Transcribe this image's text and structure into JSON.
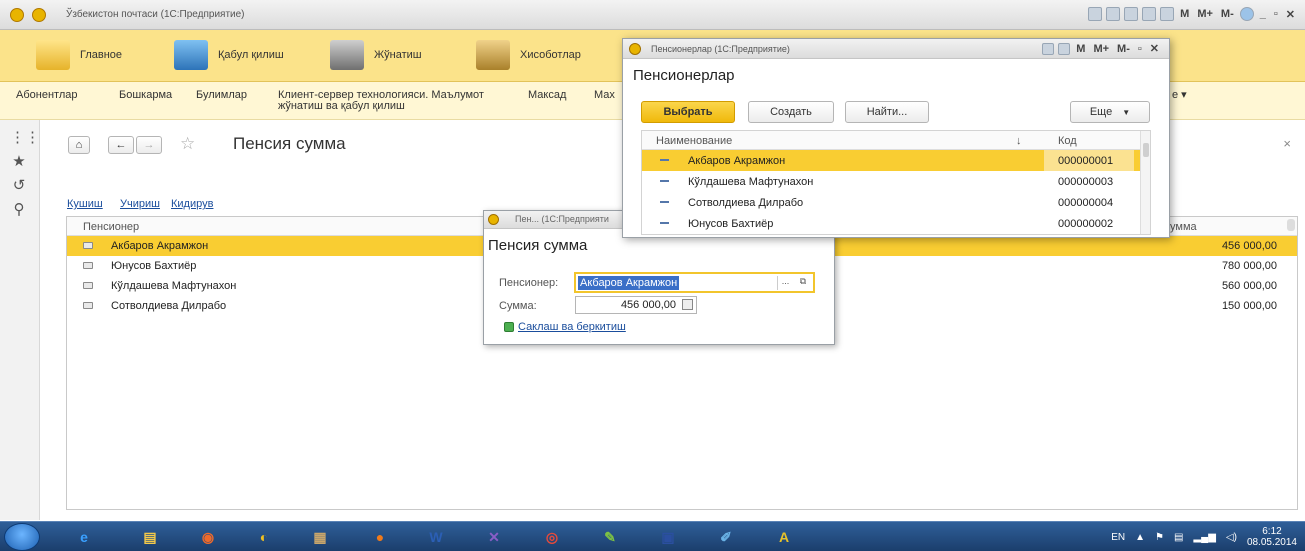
{
  "titlebar": {
    "title": "Ўзбекистон почтаси (1С:Предприятие)",
    "tools": [
      "M",
      "M+",
      "M-"
    ]
  },
  "sections": [
    {
      "label": "Главное",
      "color": "#f0c040"
    },
    {
      "label": "Қабул қилиш",
      "color": "#3a86c8"
    },
    {
      "label": "Жўнатиш",
      "color": "#7a7a7a"
    },
    {
      "label": "Хисоботлар",
      "color": "#b58a2c"
    }
  ],
  "functions": {
    "abonents": "Абонентлар",
    "boshkarma": "Бошкарма",
    "bulimlar": "Булимлар",
    "clientserver": "Клиент-сервер технологияси. Маълумот жўнатиш ва қабул қилиш",
    "maksad": "Максад",
    "max_partial": "Мах",
    "more_partial": "е ▾"
  },
  "leftbar": {
    "icons": [
      "grid-icon",
      "star-icon",
      "history-icon",
      "search-icon"
    ]
  },
  "page": {
    "home": "⌂",
    "back": "←",
    "forward": "→",
    "star": "☆",
    "title": "Пенсия сумма",
    "close": "×",
    "commands": {
      "add": "Кушиш",
      "delete": "Учириш",
      "search": "Кидирув"
    },
    "columns": {
      "pensioner": "Пенсионер",
      "sum_partial": "умма"
    },
    "rows": [
      {
        "name": "Акбаров Акрамжон",
        "sum": "456 000,00",
        "selected": true
      },
      {
        "name": "Юнусов Бахтиёр",
        "sum": "780 000,00",
        "selected": false
      },
      {
        "name": "Кўлдашева Мафтунахон",
        "sum": "560 000,00",
        "selected": false
      },
      {
        "name": "Сотволдиева Дилрабо",
        "sum": "150 000,00",
        "selected": false
      }
    ]
  },
  "form": {
    "window_title": "Пен... (1С:Предприяти",
    "title": "Пенсия сумма",
    "pensioner_label": "Пенсионер:",
    "pensioner_value": "Акбаров Акрамжон",
    "sum_label": "Сумма:",
    "sum_value": "456 000,00",
    "save_close": "Саклаш ва беркитиш",
    "dots": "...",
    "open": "⧉"
  },
  "selector": {
    "window_title": "Пенсионерлар (1С:Предприятие)",
    "tools": [
      "M",
      "M+",
      "M-"
    ],
    "title": "Пенсионерлар",
    "buttons": {
      "select": "Выбрать",
      "create": "Создать",
      "find": "Найти...",
      "more": "Еще"
    },
    "columns": {
      "name": "Наименование",
      "sort": "↓",
      "code": "Код"
    },
    "rows": [
      {
        "name": "Акбаров Акрамжон",
        "code": "000000001",
        "selected": true
      },
      {
        "name": "Кўлдашева Мафтунахон",
        "code": "000000003",
        "selected": false
      },
      {
        "name": "Сотволдиева Дилрабо",
        "code": "000000004",
        "selected": false
      },
      {
        "name": "Юнусов Бахтиёр",
        "code": "000000002",
        "selected": false
      }
    ]
  },
  "taskbar": {
    "apps": [
      {
        "name": "ie-icon",
        "glyph": "e",
        "color": "#3aa0ff"
      },
      {
        "name": "explorer-icon",
        "glyph": "▤",
        "color": "#f3c94a"
      },
      {
        "name": "media-icon",
        "glyph": "◉",
        "color": "#f06a2a"
      },
      {
        "name": "1c-icon",
        "glyph": "◐",
        "color": "#f0c020"
      },
      {
        "name": "archive-icon",
        "glyph": "▦",
        "color": "#c9a66b"
      },
      {
        "name": "firefox-icon",
        "glyph": "●",
        "color": "#f07a1a"
      },
      {
        "name": "word-icon",
        "glyph": "W",
        "color": "#2b5fb5"
      },
      {
        "name": "mail-icon",
        "glyph": "✕",
        "color": "#8a5ec7"
      },
      {
        "name": "chrome-icon",
        "glyph": "◎",
        "color": "#e84a3a"
      },
      {
        "name": "paint-icon",
        "glyph": "✎",
        "color": "#7dc243"
      },
      {
        "name": "save-icon",
        "glyph": "▣",
        "color": "#2b4fa0"
      },
      {
        "name": "brush-icon",
        "glyph": "✐",
        "color": "#6ab3e6"
      },
      {
        "name": "pdf-icon",
        "glyph": "A",
        "color": "#e8c22a"
      }
    ],
    "lang": "EN",
    "time": "6:12",
    "date": "08.05.2014"
  }
}
